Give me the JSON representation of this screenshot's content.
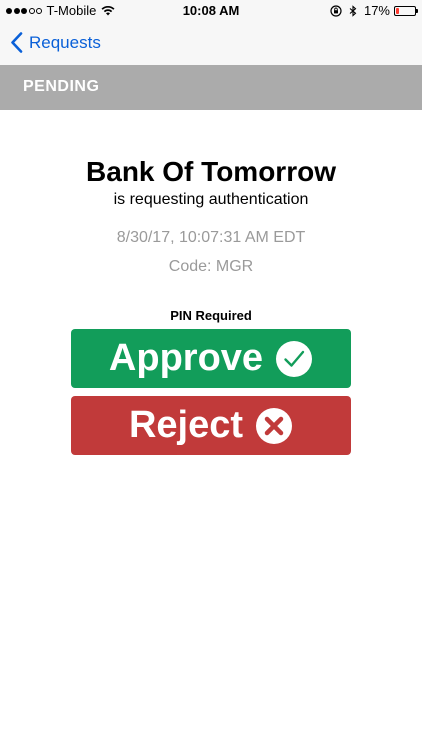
{
  "status_bar": {
    "carrier": "T-Mobile",
    "time": "10:08 AM",
    "battery": "17%",
    "battery_level": 0.17,
    "signal_bars_filled": 3,
    "signal_bars_total": 5
  },
  "nav": {
    "back_label": "Requests",
    "accent_color": "#0a60d8"
  },
  "section": {
    "label": "PENDING"
  },
  "request": {
    "requester": "Bank Of Tomorrow",
    "subtitle": "is requesting authentication",
    "timestamp": "8/30/17, 10:07:31 AM EDT",
    "code": "Code: MGR",
    "pin_label": "PIN Required"
  },
  "actions": {
    "approve_label": "Approve",
    "approve_color": "#129d5a",
    "approve_icon": "checkmark-circle-icon",
    "reject_label": "Reject",
    "reject_color": "#c13a3a",
    "reject_icon": "x-circle-icon"
  }
}
